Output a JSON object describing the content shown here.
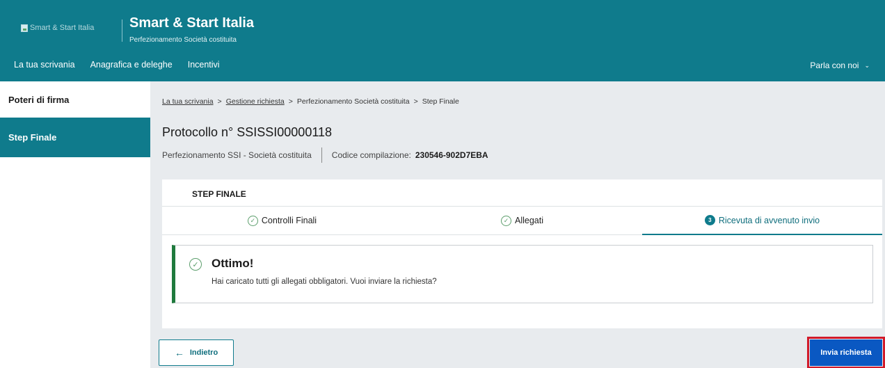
{
  "header": {
    "logo_alt": "Smart & Start Italia",
    "title": "Smart & Start Italia",
    "subtitle": "Perfezionamento Società costituita",
    "nav": [
      "La tua scrivania",
      "Anagrafica e deleghe",
      "Incentivi"
    ],
    "contact": "Parla con noi",
    "color": "#0f7b8c"
  },
  "sidebar": {
    "items": [
      {
        "label": "Poteri di firma",
        "active": false
      },
      {
        "label": "Step Finale",
        "active": true
      }
    ]
  },
  "breadcrumb": {
    "items": [
      "La tua scrivania",
      "Gestione richiesta",
      "Perfezionamento Società costituita",
      "Step Finale"
    ],
    "separator": ">"
  },
  "protocol": {
    "title": "Protocollo n° SSISSI00000118",
    "type": "Perfezionamento SSI  -  Società costituita",
    "code_label": "Codice compilazione:",
    "code_value": "230546-902D7EBA"
  },
  "step_panel": {
    "title": "STEP FINALE",
    "steps": [
      {
        "label": "Controlli Finali",
        "icon": "check-circle-icon",
        "active": false
      },
      {
        "label": "Allegati",
        "icon": "check-circle-icon",
        "active": false
      },
      {
        "label": "Ricevuta di avvenuto invio",
        "number": "3",
        "active": true
      }
    ]
  },
  "alert": {
    "title": "Ottimo!",
    "text": "Hai caricato tutti gli allegati obbligatori. Vuoi inviare la richiesta?"
  },
  "buttons": {
    "back": "Indietro",
    "submit": "Invia richiesta"
  }
}
